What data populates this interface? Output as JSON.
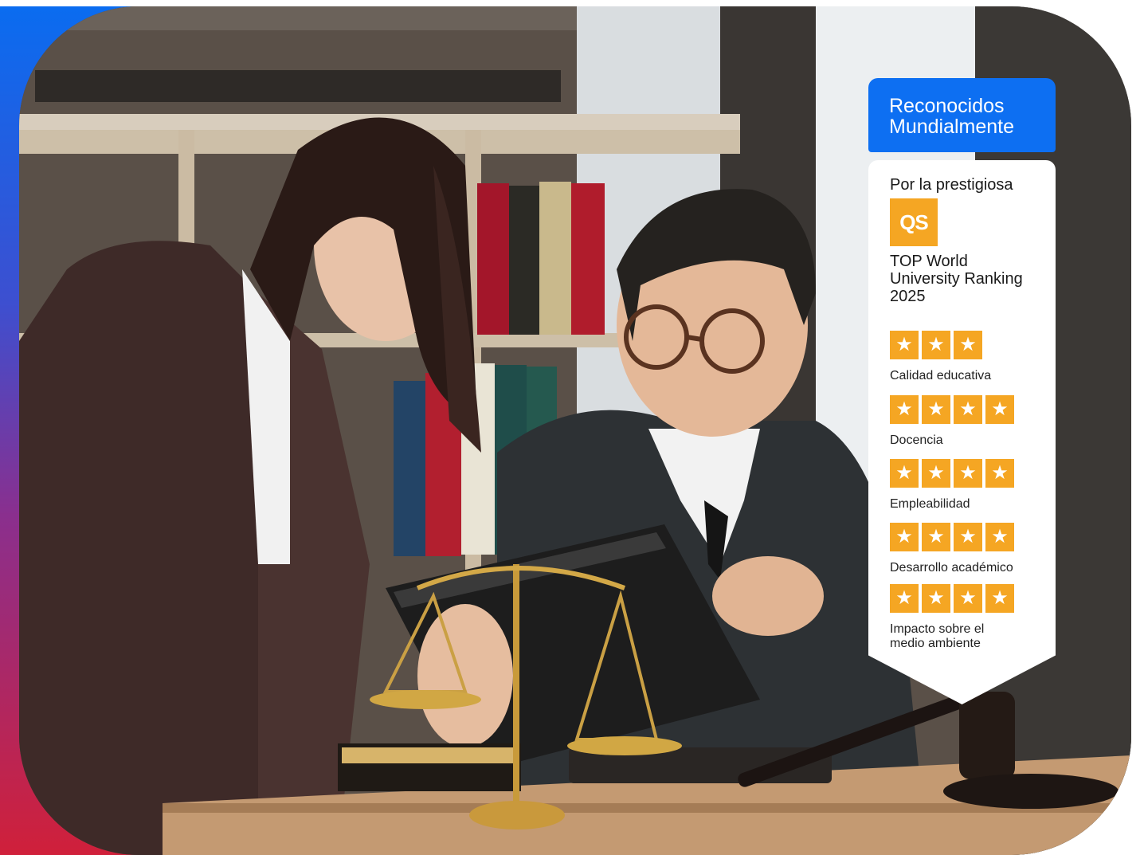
{
  "badge": {
    "header_title": "Reconocidos Mundialmente",
    "intro": "Por la prestigiosa",
    "logo_text": "QS",
    "ranking_title": "TOP World University Ranking 2025",
    "colors": {
      "header": "#0d6ff2",
      "star": "#f5a623",
      "logo": "#f5a623"
    },
    "ratings": [
      {
        "label": "Calidad educativa",
        "stars": 3
      },
      {
        "label": "Docencia",
        "stars": 4
      },
      {
        "label": "Empleabilidad",
        "stars": 4
      },
      {
        "label": "Desarrollo académico",
        "stars": 4
      },
      {
        "label": "Impacto sobre el medio ambiente",
        "stars": 4
      }
    ]
  },
  "photo": {
    "icon": "office-photo-illustration"
  }
}
